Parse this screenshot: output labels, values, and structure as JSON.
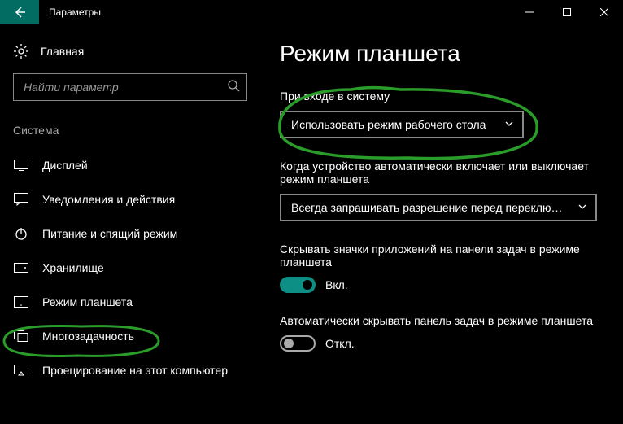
{
  "titlebar": {
    "title": "Параметры"
  },
  "sidebar": {
    "home": "Главная",
    "search_placeholder": "Найти параметр",
    "section": "Система",
    "items": [
      {
        "label": "Дисплей"
      },
      {
        "label": "Уведомления и действия"
      },
      {
        "label": "Питание и спящий режим"
      },
      {
        "label": "Хранилище"
      },
      {
        "label": "Режим планшета"
      },
      {
        "label": "Многозадачность"
      },
      {
        "label": "Проецирование на этот компьютер"
      }
    ]
  },
  "main": {
    "title": "Режим планшета",
    "signin_label": "При входе в систему",
    "signin_value": "Использовать режим рабочего стола",
    "autoswitch_label": "Когда устройство автоматически включает или выключает режим планшета",
    "autoswitch_value": "Всегда запрашивать разрешение перед переклю…",
    "hideicons_label": "Скрывать значки приложений на панели задач в режиме планшета",
    "hideicons_state": "Вкл.",
    "hidetaskbar_label": "Автоматически скрывать панель задач в режиме планшета",
    "hidetaskbar_state": "Откл."
  }
}
